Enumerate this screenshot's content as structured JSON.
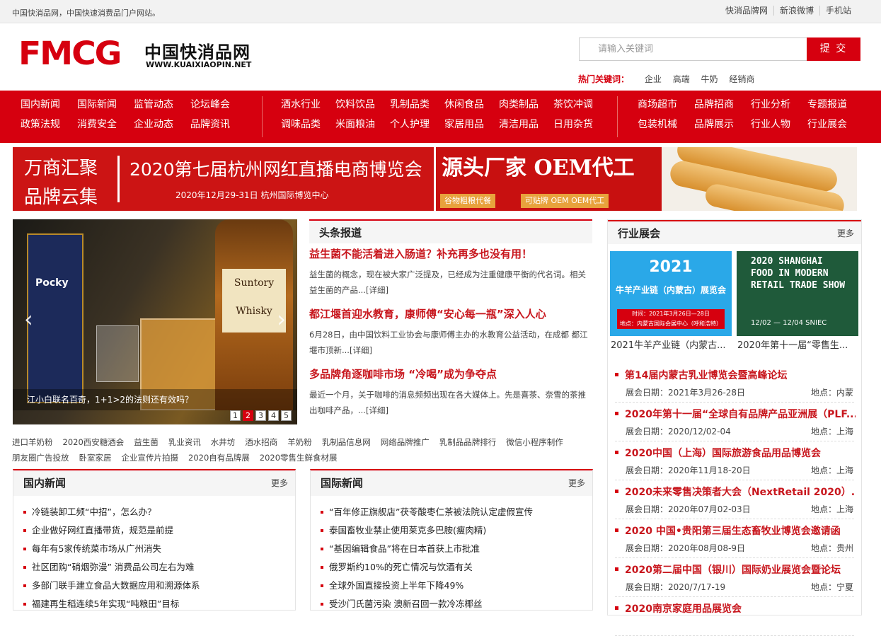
{
  "topbar": {
    "slogan": "中国快消品网，中国快速消费品门户网站。",
    "links": [
      "快消品牌网",
      "新浪微博",
      "手机站"
    ]
  },
  "logo": {
    "mark": "FMCG",
    "cn": "中国快消品网",
    "en": "WWW.KUAIXIAOPIN.NET"
  },
  "search": {
    "placeholder": "请输入关键词",
    "button": "提 交"
  },
  "hot": {
    "label": "热门关键词：",
    "words": [
      "企业",
      "高端",
      "牛奶",
      "经销商"
    ]
  },
  "nav": {
    "g1": [
      "国内新闻",
      "国际新闻",
      "监管动态",
      "论坛峰会",
      "政策法规",
      "消费安全",
      "企业动态",
      "品牌资讯"
    ],
    "g2": [
      "酒水行业",
      "饮料饮品",
      "乳制品类",
      "休闲食品",
      "肉类制品",
      "茶饮冲调",
      "调味品类",
      "米面粮油",
      "个人护理",
      "家居用品",
      "清洁用品",
      "日用杂货"
    ],
    "g3": [
      "商场超市",
      "品牌招商",
      "行业分析",
      "专题报道",
      "包装机械",
      "品牌展示",
      "行业人物",
      "行业展会"
    ]
  },
  "banner1": {
    "l1": "万商汇聚",
    "l2": "品牌云集",
    "title": "2020第七届杭州网红直播电商博览会",
    "date": "2020年12月29-31日 杭州国际博览中心"
  },
  "banner2": {
    "title": "源头厂家 OEM代工",
    "tag1": "谷物粗粮代餐",
    "tag2": "可贴牌 OEM OEM代工"
  },
  "slider": {
    "caption": "江小白联名百奇，1+1>2的法则还有效吗？",
    "pages": [
      "1",
      "2",
      "3",
      "4",
      "5"
    ],
    "active": 2,
    "bottle_label": "Suntory Whisky",
    "pocky_label": "Pocky",
    "prev": "‹",
    "next": "›"
  },
  "headlines": {
    "title": "头条报道",
    "items": [
      {
        "h": "益生菌不能活着进入肠道？补充再多也没有用！",
        "p": "益生菌的概念，现在被大家广泛提及，已经成为注重健康平衡的代名词。相关益生菌的产品...[详细]"
      },
      {
        "h": "都江堰首迎水教育，康师傅“安心每一瓶”深入人心",
        "p": "6月28日，由中国饮料工业协会与康师傅主办的水教育公益活动，在成都 都江堰市顶新...[详细]"
      },
      {
        "h": "多品牌角逐咖啡市场 “冷喝”成为争夺点",
        "p": "最近一个月，关于咖啡的消息频频出现在各大媒体上。先是喜茶、奈雪的茶推出咖啡产品，...[详细]"
      }
    ]
  },
  "tags": [
    "进口羊奶粉",
    "2020西安糖酒会",
    "益生菌",
    "乳业资讯",
    "水井坊",
    "酒水招商",
    "羊奶粉",
    "乳制品信息网",
    "网络品牌推广",
    "乳制品品牌排行",
    "微信小程序制作",
    "朋友圈广告投放",
    "卧室家居",
    "企业宣传片拍摄",
    "2020自有品牌展",
    "2020零售生鲜食材展"
  ],
  "domestic": {
    "title": "国内新闻",
    "more": "更多",
    "items": [
      "冷链装卸工频“中招”，怎么办？",
      "企业做好网红直播带货，规范是前提",
      "每年有5家传统菜市场从广州消失",
      "社区团购“硝烟弥漫” 消费品公司左右为难",
      "多部门联手建立食品大数据应用和溯源体系",
      "福建再生稻连续5年实现“吨粮田”目标"
    ]
  },
  "international": {
    "title": "国际新闻",
    "more": "更多",
    "items": [
      "“百年修正旗舰店”茯苓酸枣仁茶被法院认定虚假宣传",
      "泰国畜牧业禁止使用莱克多巴胺(瘦肉精)",
      "“基因编辑食品”将在日本首获上市批准",
      "俄罗斯约10%的死亡情况与饮酒有关",
      "全球外国直接投资上半年下降49%",
      "受沙门氏菌污染 澳新召回一款冷冻椰丝"
    ]
  },
  "expo": {
    "title": "行业展会",
    "more": "更多",
    "pic1": {
      "big": "2021",
      "mid": "牛羊产业链（内蒙古）展览会",
      "bar1": "时间：2021年3月26日—28日",
      "bar2": "地点：内蒙古国际会展中心（呼和浩特）",
      "caption": "2021牛羊产业链（内蒙古..."
    },
    "pic2": {
      "txt": "2020 SHANGHAI\nFOOD IN MODERN\nRETAIL TRADE SHOW",
      "sub": "12/02 — 12/04  SNIEC",
      "caption": "2020年第十一届“零售生..."
    },
    "items": [
      {
        "t": "第14届内蒙古乳业博览会暨高峰论坛",
        "d": "展会日期：2021年3月26-28日",
        "l": "地点：内蒙"
      },
      {
        "t": "2020年第十一届“全球自有品牌产品亚洲展（PLF...",
        "d": "展会日期：2020/12/02-04",
        "l": "地点：上海"
      },
      {
        "t": "2020中国（上海）国际旅游食品用品博览会",
        "d": "展会日期：2020年11月18-20日",
        "l": "地点：上海"
      },
      {
        "t": "2020未来零售决策者大会（NextRetail 2020）...",
        "d": "展会日期：2020年07月02-03日",
        "l": "地点：上海"
      },
      {
        "t": "2020 中国•贵阳第三届生态畜牧业博览会邀请函",
        "d": "展会日期：2020年08月08-9日",
        "l": "地点：贵州"
      },
      {
        "t": "2020第二届中国（银川）国际奶业展览会暨论坛",
        "d": "展会日期：2020/7/17-19",
        "l": "地点：宁夏"
      },
      {
        "t": "2020南京家庭用品展览会",
        "d": "",
        "l": ""
      }
    ]
  }
}
